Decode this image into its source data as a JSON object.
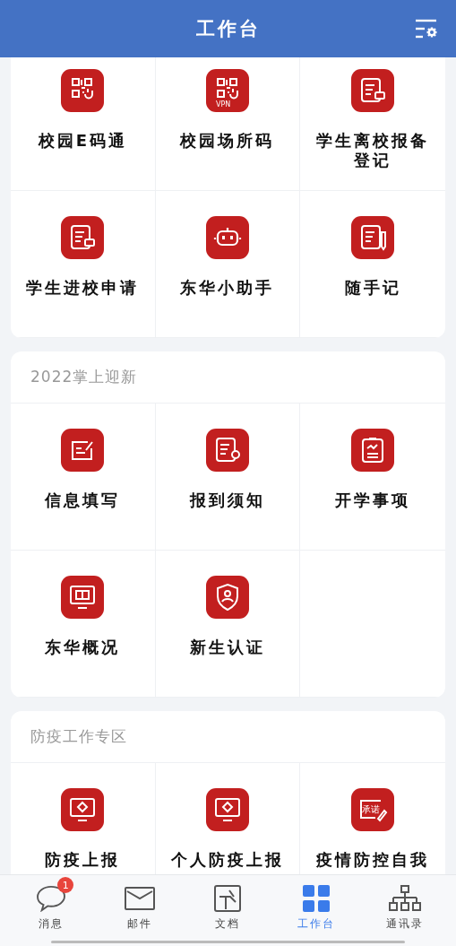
{
  "header": {
    "title": "工作台"
  },
  "sections": [
    {
      "items": [
        {
          "label": "校园E码通"
        },
        {
          "label": "校园场所码",
          "icon_text": "VPN"
        },
        {
          "label": "学生离校报备登记"
        },
        {
          "label": "学生进校申请"
        },
        {
          "label": "东华小助手"
        },
        {
          "label": "随手记"
        }
      ]
    },
    {
      "title": "2022掌上迎新",
      "items": [
        {
          "label": "信息填写"
        },
        {
          "label": "报到须知"
        },
        {
          "label": "开学事项"
        },
        {
          "label": "东华概况"
        },
        {
          "label": "新生认证"
        }
      ]
    },
    {
      "title": "防疫工作专区",
      "items": [
        {
          "label": "防疫上报"
        },
        {
          "label": "个人防疫上报"
        },
        {
          "label": "疫情防控自我",
          "icon_text": "承诺"
        }
      ]
    }
  ],
  "tab_bar": [
    {
      "label": "消息",
      "badge": "1",
      "selected": false
    },
    {
      "label": "邮件",
      "selected": false
    },
    {
      "label": "文档",
      "selected": false
    },
    {
      "label": "工作台",
      "selected": true
    },
    {
      "label": "通讯录",
      "selected": false
    }
  ]
}
